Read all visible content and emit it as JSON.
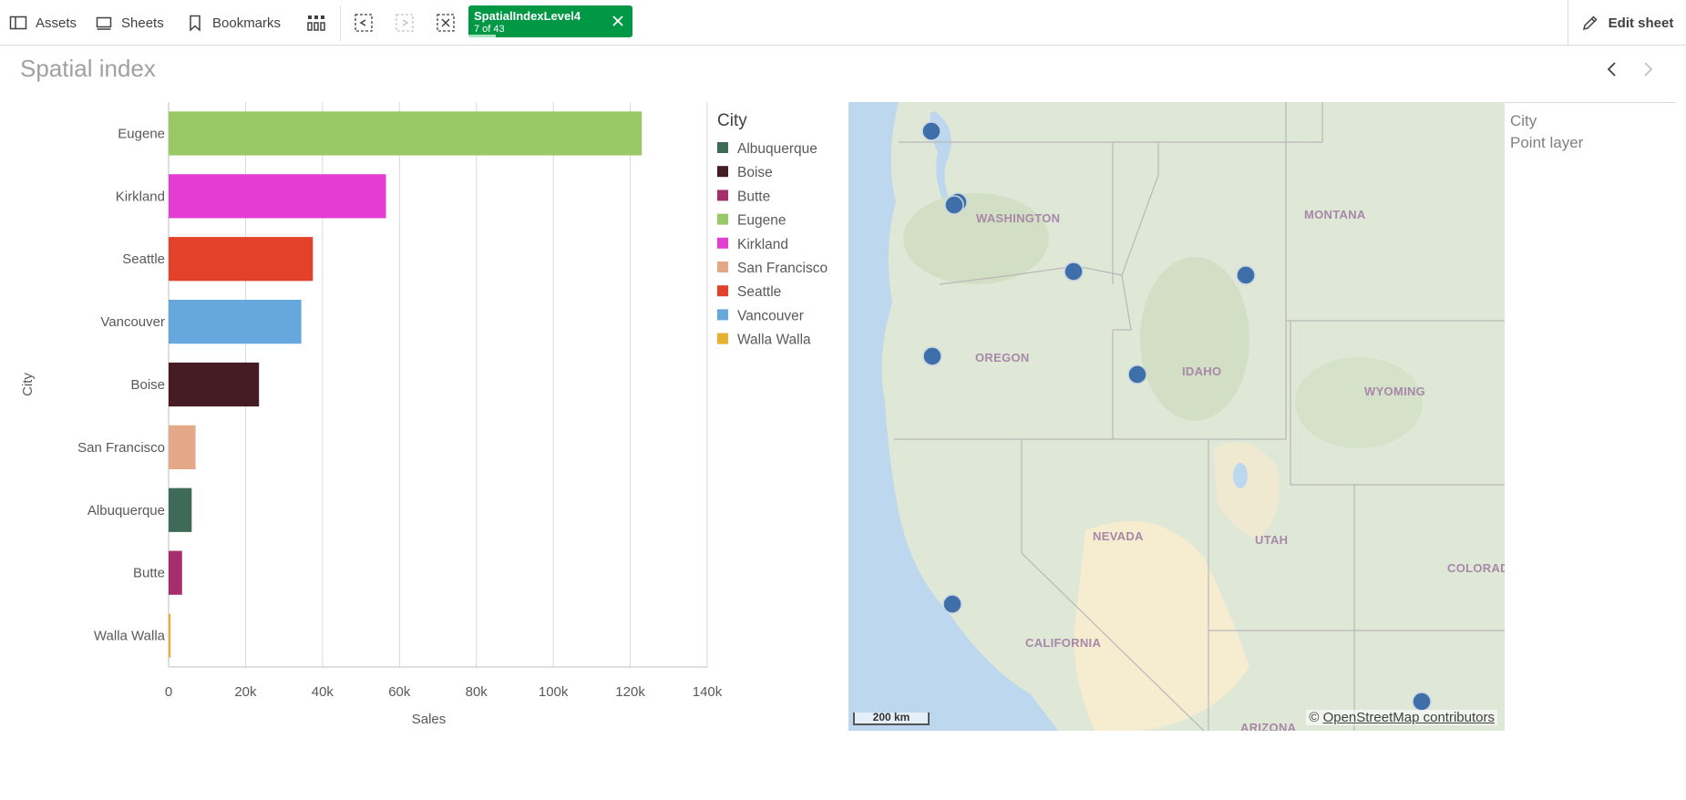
{
  "toolbar": {
    "assets_label": "Assets",
    "sheets_label": "Sheets",
    "bookmarks_label": "Bookmarks",
    "selection": {
      "field": "SpatialIndexLevel4",
      "count": "7 of 43"
    },
    "edit_sheet_label": "Edit sheet"
  },
  "sheet": {
    "title": "Spatial index"
  },
  "chart_data": {
    "type": "bar",
    "orientation": "horizontal",
    "categories": [
      "Eugene",
      "Kirkland",
      "Seattle",
      "Vancouver",
      "Boise",
      "San Francisco",
      "Albuquerque",
      "Butte",
      "Walla Walla"
    ],
    "values": [
      123000,
      56500,
      37500,
      34500,
      23500,
      7000,
      6000,
      3500,
      500
    ],
    "colors": [
      "#99c966",
      "#e33dd4",
      "#e3412a",
      "#66a8de",
      "#451c24",
      "#e3a888",
      "#3d6b57",
      "#a62e6b",
      "#e8b02e"
    ],
    "xlabel": "Sales",
    "ylabel": "City",
    "xlim": [
      0,
      140000
    ],
    "ticks": [
      "0",
      "20k",
      "40k",
      "60k",
      "80k",
      "100k",
      "120k",
      "140k"
    ],
    "tick_values": [
      0,
      20000,
      40000,
      60000,
      80000,
      100000,
      120000,
      140000
    ],
    "grid": true,
    "legend": {
      "title": "City",
      "placement": "right",
      "items": [
        {
          "label": "Albuquerque",
          "color": "#3d6b57"
        },
        {
          "label": "Boise",
          "color": "#451c24"
        },
        {
          "label": "Butte",
          "color": "#a62e6b"
        },
        {
          "label": "Eugene",
          "color": "#99c966"
        },
        {
          "label": "Kirkland",
          "color": "#e33dd4"
        },
        {
          "label": "San Francisco",
          "color": "#e3a888"
        },
        {
          "label": "Seattle",
          "color": "#e3412a"
        },
        {
          "label": "Vancouver",
          "color": "#66a8de"
        },
        {
          "label": "Walla Walla",
          "color": "#e8b02e"
        }
      ]
    }
  },
  "map": {
    "labels": [
      "WASHINGTON",
      "MONTANA",
      "OREGON",
      "IDAHO",
      "WYOMING",
      "NEVADA",
      "UTAH",
      "COLORADO",
      "CALIFORNIA",
      "ARIZONA"
    ],
    "scale_label": "200 km",
    "attribution_prefix": "©",
    "attribution_link": "OpenStreetMap contributors",
    "point_color": "#3f6fa8",
    "legend_title": "City",
    "legend_layer": "Point layer"
  }
}
